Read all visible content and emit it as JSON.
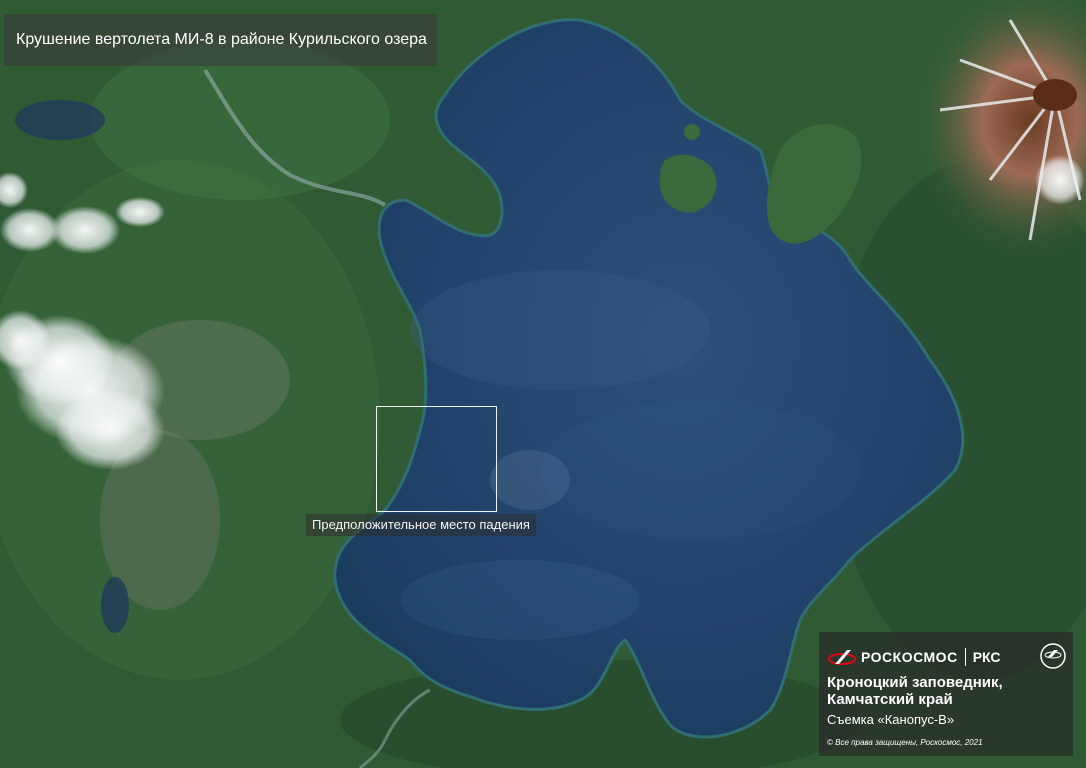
{
  "title": "Крушение вертолета МИ-8 в районе Курильского озера",
  "marker": {
    "label": "Предположительное место падения"
  },
  "info_panel": {
    "brand_primary": "РОСКОСМОС",
    "brand_secondary": "РКС",
    "location_line1": "Кроноцкий заповедник,",
    "location_line2": "Камчатский край",
    "capture": "Съемка «Канопус-В»",
    "copyright": "© Все права защищены, Роскосмос, 2021"
  },
  "colors": {
    "forest": "#2f5a34",
    "lake": "#1d3f66",
    "panel": "#282828",
    "accent_red": "#e30613"
  }
}
